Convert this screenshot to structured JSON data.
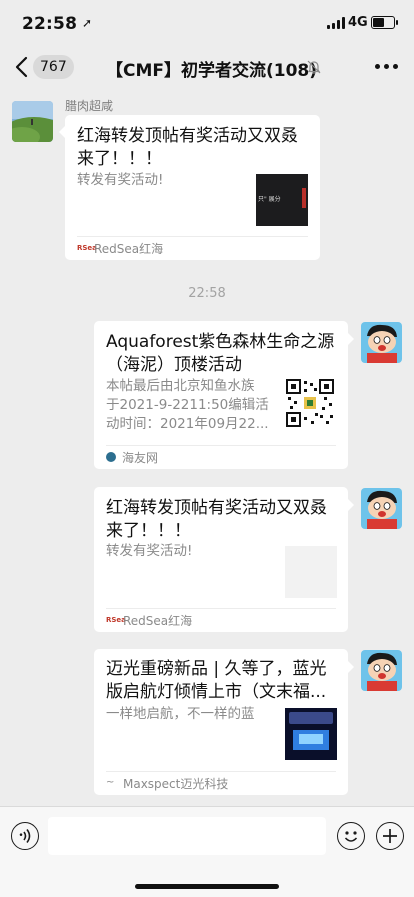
{
  "status_bar": {
    "time": "22:58",
    "network": "4G"
  },
  "nav": {
    "unread_count": "767",
    "title": "【CMF】初学者交流(108)"
  },
  "first_message": {
    "sender": "腊肉超咸",
    "card": {
      "title_line1": "红海转发顶帖有奖活动又双叒",
      "title_line2": "来了！！！",
      "desc": "转发有奖活动!",
      "source": "RedSea红海",
      "thumb_text": "只\" 展分"
    }
  },
  "timestamp": "22:58",
  "messages": [
    {
      "title_line1": "Aquaforest紫色森林生命之源",
      "title_line2": "（海泥）顶楼活动",
      "desc_line1": "本帖最后由北京知鱼水族",
      "desc_line2": "于2021-9-2211:50编辑活",
      "desc_line3": "动时间：2021年09月22...",
      "source": "海友网"
    },
    {
      "title_line1": "红海转发顶帖有奖活动又双叒",
      "title_line2": "来了！！！",
      "desc_line1": "转发有奖活动!",
      "source": "RedSea红海"
    },
    {
      "title_line1": "迈光重磅新品 | 久等了，蓝光",
      "title_line2": "版启航灯倾情上市（文末福...",
      "desc_line1": "一样地启航，不一样的蓝",
      "source": "Maxspect迈光科技"
    }
  ],
  "icons": {
    "voice": "voice-icon",
    "emoji": "emoji-icon",
    "plus": "plus-icon",
    "back": "chevron-left-icon",
    "mute": "mute-bell-icon",
    "more": "more-dots-icon"
  },
  "colors": {
    "background": "#ededed",
    "card": "#ffffff",
    "bottom_bar": "#f7f7f7"
  }
}
